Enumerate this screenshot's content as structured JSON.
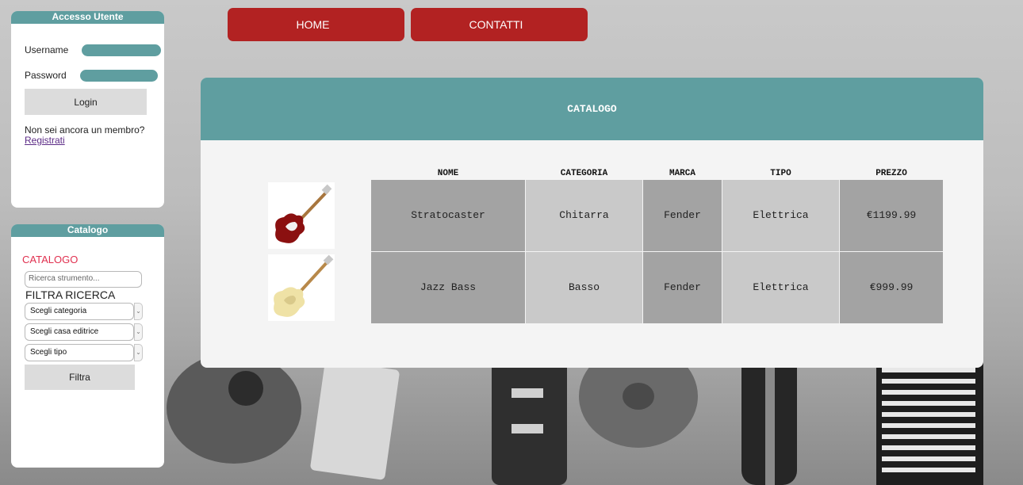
{
  "login": {
    "title": "Accesso Utente",
    "username_label": "Username",
    "password_label": "Password",
    "login_button": "Login",
    "not_member_text": "Non sei ancora un membro?",
    "register_link": "Registrati"
  },
  "catalog_panel": {
    "title": "Catalogo",
    "heading": "CATALOGO",
    "search_placeholder": "Ricerca strumento...",
    "filter_heading": "FILTRA RICERCA",
    "select_category": "Scegli categoria",
    "select_publisher": "Scegli casa editrice",
    "select_type": "Scegli tipo",
    "filter_button": "Filtra"
  },
  "nav": {
    "home": "HOME",
    "contatti": "CONTATTI"
  },
  "main": {
    "title": "CATALOGO",
    "columns": [
      "NOME",
      "CATEGORIA",
      "MARCA",
      "TIPO",
      "PREZZO"
    ],
    "rows": [
      {
        "image": "red-electric-guitar-icon",
        "nome": "Stratocaster",
        "categoria": "Chitarra",
        "marca": "Fender",
        "tipo": "Elettrica",
        "prezzo": "€1199.99"
      },
      {
        "image": "cream-bass-guitar-icon",
        "nome": "Jazz Bass",
        "categoria": "Basso",
        "marca": "Fender",
        "tipo": "Elettrica",
        "prezzo": "€999.99"
      }
    ]
  },
  "colors": {
    "teal": "#5f9ea0",
    "nav_red": "#b22222",
    "catalog_heading_red": "#e0304f"
  }
}
